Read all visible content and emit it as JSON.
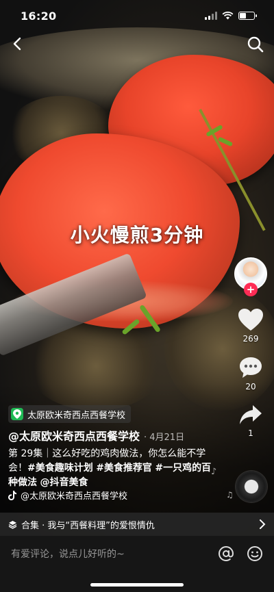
{
  "status_bar": {
    "time": "16:20"
  },
  "video": {
    "caption": "小火慢煎3分钟"
  },
  "actions": {
    "likes": "269",
    "comments": "20",
    "shares": "1"
  },
  "location": {
    "name": "太原欧米奇西点西餐学校"
  },
  "author": {
    "handle": "@太原欧米奇西点西餐学校",
    "date": "· 4月21日"
  },
  "description": {
    "text": "第 29集｜这么好吃的鸡肉做法，你怎么能不学会！",
    "tags": [
      "#美食趣味计划",
      "#美食推荐官",
      "#一只鸡的百种做法",
      "@抖音美食"
    ]
  },
  "music": {
    "title": "@太原欧米奇西点西餐学校"
  },
  "collection": {
    "label": "合集 · 我与“西餐料理”的爱恨情仇"
  },
  "comment_bar": {
    "placeholder": "有爱评论，说点儿好听的~"
  },
  "colors": {
    "follow": "#fe2c55",
    "location_icon": "#1fb954"
  }
}
